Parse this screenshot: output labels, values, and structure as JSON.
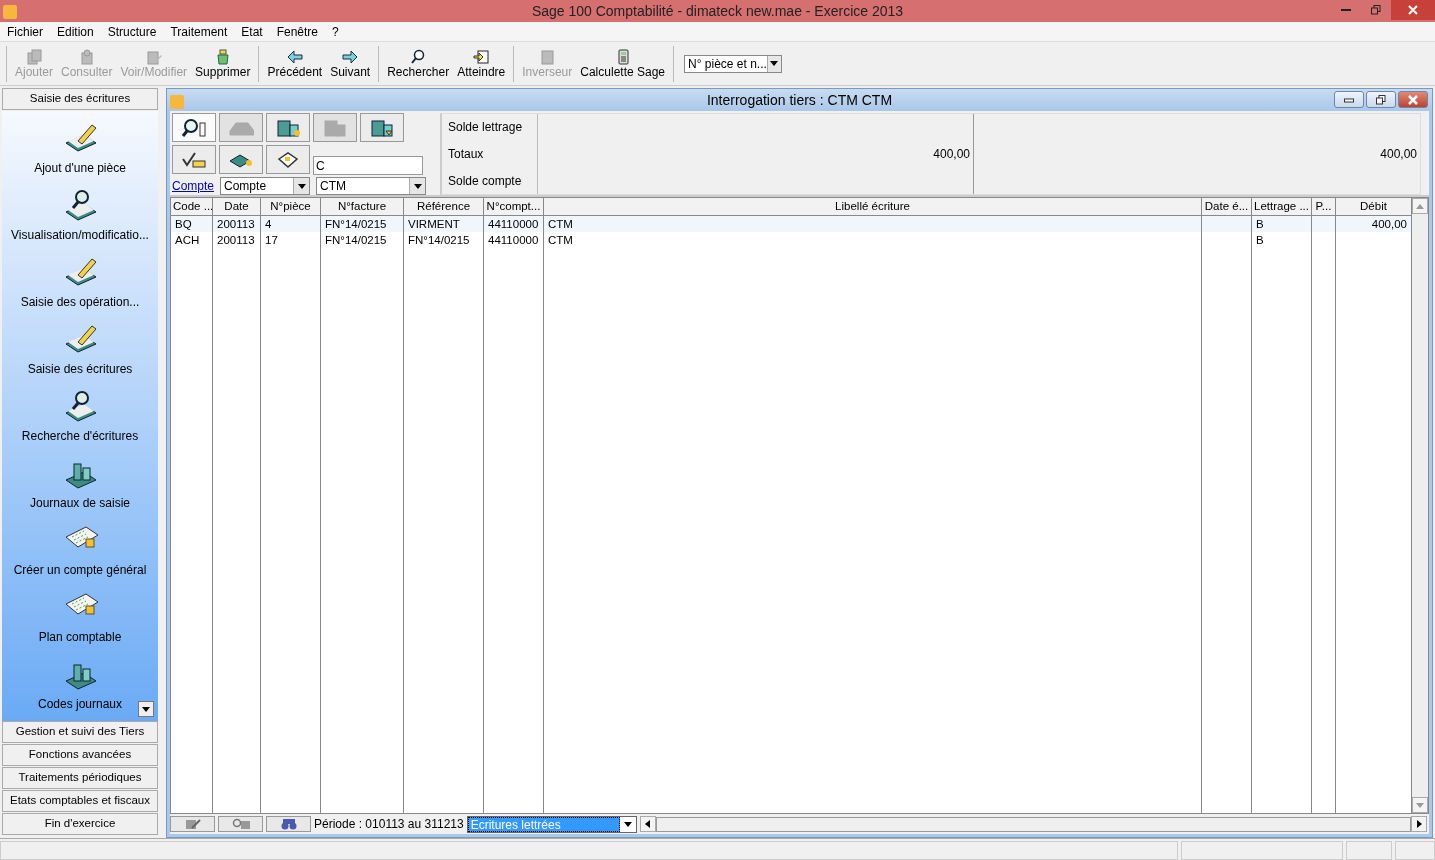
{
  "window": {
    "title": "Sage 100 Comptabilité - dimateck new.mae - Exercice 2013"
  },
  "menu": [
    "Fichier",
    "Edition",
    "Structure",
    "Traitement",
    "Etat",
    "Fenêtre",
    "?"
  ],
  "toolbar": {
    "groups": [
      [
        {
          "label": "Ajouter",
          "disabled": true
        },
        {
          "label": "Consulter",
          "disabled": true
        },
        {
          "label": "Voir/Modifier",
          "disabled": true
        },
        {
          "label": "Supprimer",
          "disabled": false
        }
      ],
      [
        {
          "label": "Précédent",
          "disabled": false
        },
        {
          "label": "Suivant",
          "disabled": false
        }
      ],
      [
        {
          "label": "Rechercher",
          "disabled": false
        },
        {
          "label": "Atteindre",
          "disabled": false
        }
      ],
      [
        {
          "label": "Inverseur",
          "disabled": true
        },
        {
          "label": "Calculette Sage",
          "disabled": false
        }
      ]
    ],
    "sort_combo": "N° pièce et n..."
  },
  "sidebar": {
    "sections": [
      {
        "label": "Saisie des écritures",
        "items": [
          "Ajout d'une pièce",
          "Visualisation/modificatio...",
          "Saisie des opération...",
          "Saisie des écritures",
          "Recherche d'écritures",
          "Journaux de saisie",
          "Créer un compte général",
          "Plan comptable",
          "Codes journaux"
        ]
      },
      {
        "label": "Gestion et suivi des Tiers"
      },
      {
        "label": "Fonctions avancées"
      },
      {
        "label": "Traitements périodiques"
      },
      {
        "label": "Etats comptables et fiscaux"
      },
      {
        "label": "Fin d'exercice"
      }
    ]
  },
  "child_window": {
    "title": "Interrogation tiers :  CTM CTM",
    "tool_buttons": [
      {
        "disabled": false
      },
      {
        "disabled": true
      },
      {
        "disabled": false
      },
      {
        "disabled": true
      },
      {
        "disabled": false
      },
      {
        "disabled": false
      },
      {
        "disabled": false
      },
      {
        "disabled": false
      }
    ],
    "filter": {
      "value": "C",
      "link": "Compte",
      "type_combo": "Compte",
      "account_combo": "CTM"
    },
    "summary": {
      "labels": [
        "Solde lettrage",
        "Totaux",
        "Solde compte"
      ],
      "totals_debit": "400,00",
      "totals_credit": "400,00"
    },
    "table": {
      "columns": [
        "Code ...",
        "Date",
        "N°pièce",
        "N°facture",
        "Référence",
        "N°compt...",
        "Libellé écriture",
        "Date é...",
        "Lettrage ...",
        "P...",
        "Débit"
      ],
      "rows": [
        {
          "selected": true,
          "cells": [
            "BQ",
            "200113",
            "4",
            "FN°14/0215",
            "VIRMENT",
            "44110000",
            "CTM",
            "",
            "B",
            "",
            "400,00"
          ]
        },
        {
          "selected": false,
          "cells": [
            "ACH",
            "200113",
            "17",
            "FN°14/0215",
            "FN°14/0215",
            "44110000",
            "CTM",
            "",
            "B",
            "",
            ""
          ]
        }
      ]
    },
    "footer": {
      "period": "Période : 010113 au 311213",
      "view_combo": "Ecritures lettrées"
    }
  }
}
